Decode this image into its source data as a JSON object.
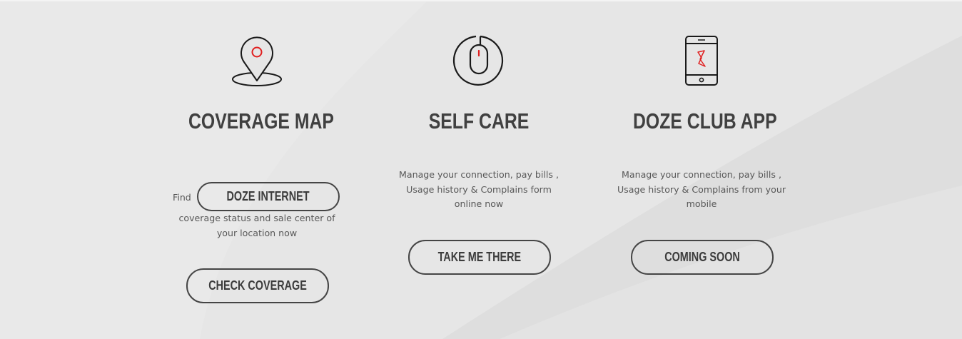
{
  "colors": {
    "accent": "#e02020",
    "text": "#404040",
    "background": "#e6e6e6"
  },
  "cards": [
    {
      "icon": "map-pin-icon",
      "title": "COVERAGE MAP",
      "find_prefix": "Find",
      "inline_button": "DOZE INTERNET",
      "description": "coverage status and sale center of your location now",
      "button": "CHECK COVERAGE"
    },
    {
      "icon": "mouse-icon",
      "title": "SELF CARE",
      "description": "Manage your connection, pay bills , Usage history & Complains form online now",
      "button": "TAKE ME THERE"
    },
    {
      "icon": "mobile-app-icon",
      "title": "DOZE CLUB APP",
      "description": "Manage your connection, pay bills , Usage history & Complains from your mobile",
      "button": "COMING SOON"
    }
  ]
}
